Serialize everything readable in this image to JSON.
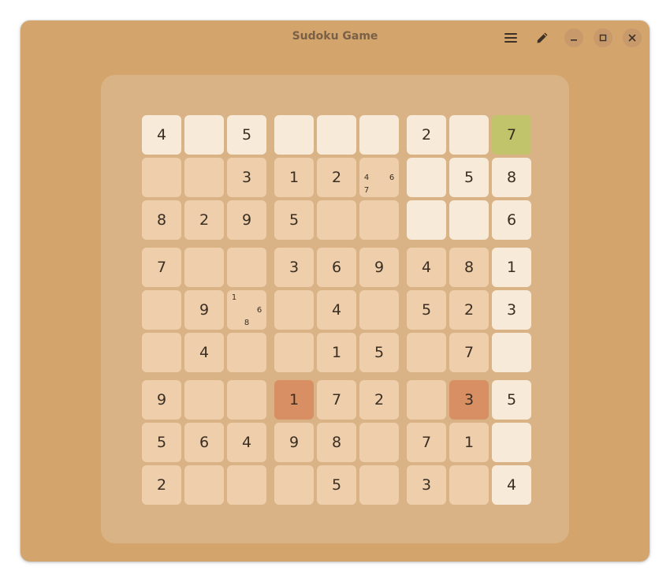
{
  "window": {
    "title": "Sudoku Game"
  },
  "titlebar": {
    "icons": [
      "menu-icon",
      "pencil-icon",
      "minimize-icon",
      "maximize-icon",
      "close-icon"
    ]
  },
  "colors": {
    "window_bg": "#d3a56d",
    "board_bg": "#d9b385",
    "cell_plain": "#eeceab",
    "cell_light": "#f7ead8",
    "cell_selected": "#c1c46a",
    "cell_conflict": "#d88f64"
  },
  "board": {
    "values": [
      [
        "4",
        "",
        "5",
        "",
        "",
        "",
        "2",
        "",
        "7"
      ],
      [
        "",
        "",
        "3",
        "1",
        "2",
        "",
        "",
        "5",
        "8"
      ],
      [
        "8",
        "2",
        "9",
        "5",
        "",
        "",
        "",
        "",
        "6"
      ],
      [
        "7",
        "",
        "",
        "3",
        "6",
        "9",
        "4",
        "8",
        "1"
      ],
      [
        "",
        "9",
        "",
        "",
        "4",
        "",
        "5",
        "2",
        "3"
      ],
      [
        "",
        "4",
        "",
        "",
        "1",
        "5",
        "",
        "7",
        ""
      ],
      [
        "9",
        "",
        "",
        "1",
        "7",
        "2",
        "",
        "3",
        "5"
      ],
      [
        "5",
        "6",
        "4",
        "9",
        "8",
        "",
        "7",
        "1",
        ""
      ],
      [
        "2",
        "",
        "",
        "",
        "5",
        "",
        "3",
        "",
        "4"
      ]
    ],
    "states": [
      [
        "light",
        "light",
        "light",
        "light",
        "light",
        "light",
        "light",
        "light",
        "selected"
      ],
      [
        "plain",
        "plain",
        "plain",
        "plain",
        "plain",
        "plain",
        "light",
        "light",
        "light"
      ],
      [
        "plain",
        "plain",
        "plain",
        "plain",
        "plain",
        "plain",
        "light",
        "light",
        "light"
      ],
      [
        "plain",
        "plain",
        "plain",
        "plain",
        "plain",
        "plain",
        "plain",
        "plain",
        "light"
      ],
      [
        "plain",
        "plain",
        "plain",
        "plain",
        "plain",
        "plain",
        "plain",
        "plain",
        "light"
      ],
      [
        "plain",
        "plain",
        "plain",
        "plain",
        "plain",
        "plain",
        "plain",
        "plain",
        "light"
      ],
      [
        "plain",
        "plain",
        "plain",
        "conflict",
        "plain",
        "plain",
        "plain",
        "conflict",
        "light"
      ],
      [
        "plain",
        "plain",
        "plain",
        "plain",
        "plain",
        "plain",
        "plain",
        "plain",
        "light"
      ],
      [
        "plain",
        "plain",
        "plain",
        "plain",
        "plain",
        "plain",
        "plain",
        "plain",
        "light"
      ]
    ],
    "notes": [
      {
        "row": 1,
        "col": 5,
        "digits": [
          "4",
          "6",
          "7"
        ]
      },
      {
        "row": 4,
        "col": 2,
        "digits": [
          "1",
          "6",
          "8"
        ]
      }
    ]
  }
}
